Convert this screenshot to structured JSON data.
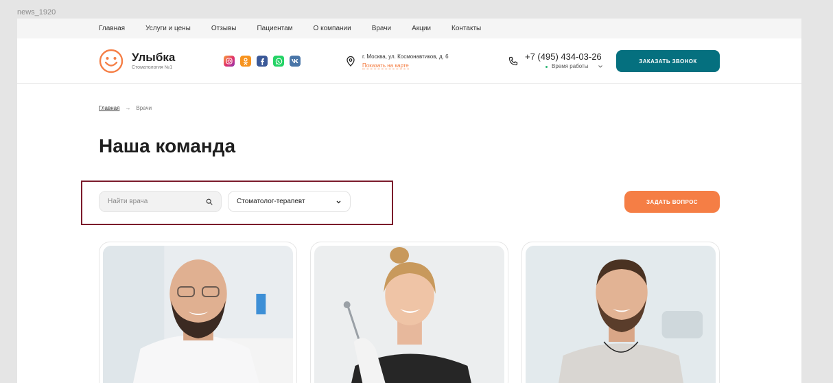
{
  "frame": {
    "label": "news_1920"
  },
  "nav": {
    "items": [
      {
        "label": "Главная"
      },
      {
        "label": "Услуги и цены"
      },
      {
        "label": "Отзывы"
      },
      {
        "label": "Пациентам"
      },
      {
        "label": "О компании"
      },
      {
        "label": "Врачи"
      },
      {
        "label": "Акции"
      },
      {
        "label": "Контакты"
      }
    ]
  },
  "header": {
    "brand_name": "Улыбка",
    "brand_sub": "Стоматология №1",
    "socials": [
      "instagram-icon",
      "odnoklassniki-icon",
      "facebook-icon",
      "whatsapp-icon",
      "vk-icon"
    ],
    "address": "г. Москва, ул. Космонавтиков, д. 6",
    "map_link": "Показать на карте",
    "phone": "+7 (495) 434-03-26",
    "hours": "Время работы",
    "call_button": "ЗАКАЗАТЬ ЗВОНОК"
  },
  "breadcrumb": {
    "home": "Главная",
    "separator": "→",
    "current": "Врачи"
  },
  "page_title": "Наша команда",
  "filters": {
    "search_placeholder": "Найти врача",
    "specialty_selected": "Стоматолог-терапевт"
  },
  "ask_button": "ЗАДАТЬ ВОПРОС",
  "colors": {
    "teal": "#05707f",
    "orange": "#f57e45",
    "link": "#f47a3d",
    "highlight": "#7b1a2b"
  }
}
